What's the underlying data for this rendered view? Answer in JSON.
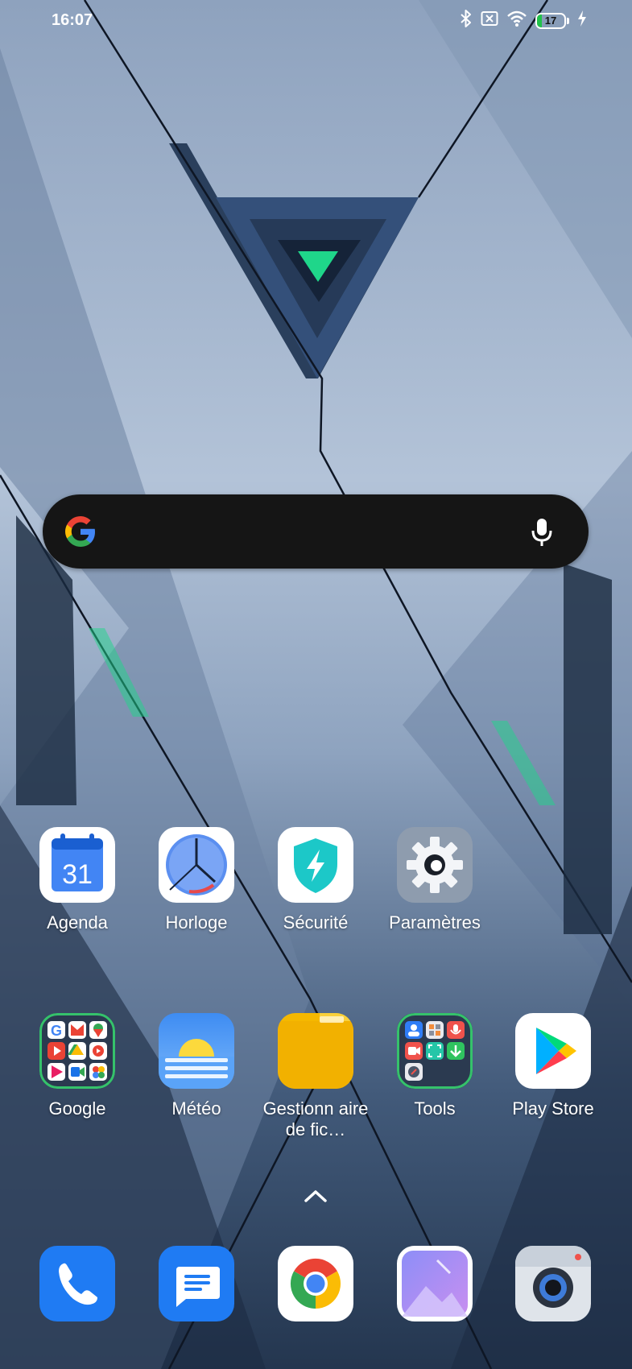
{
  "status_bar": {
    "time": "16:07",
    "icons": [
      "bluetooth-icon",
      "no-sim-icon",
      "wifi-icon",
      "battery-icon",
      "charging-icon"
    ],
    "battery_level": "17",
    "battery_fraction": 0.17
  },
  "search": {
    "icons": [
      "google-g-icon",
      "microphone-icon"
    ]
  },
  "home_row_1": [
    {
      "label": "Agenda",
      "icon": "calendar-icon",
      "badge_text": "31"
    },
    {
      "label": "Horloge",
      "icon": "clock-icon"
    },
    {
      "label": "Sécurité",
      "icon": "security-shield-icon"
    },
    {
      "label": "Paramètres",
      "icon": "settings-gear-icon"
    }
  ],
  "home_row_2": [
    {
      "label": "Google",
      "icon": "google-folder-icon"
    },
    {
      "label": "Météo",
      "icon": "weather-icon"
    },
    {
      "label": "Gestionn aire de fic…",
      "icon": "file-manager-folder-icon"
    },
    {
      "label": "Tools",
      "icon": "tools-folder-icon"
    },
    {
      "label": "Play Store",
      "icon": "play-store-icon"
    }
  ],
  "dock": [
    {
      "name": "phone",
      "icon": "phone-icon"
    },
    {
      "name": "messages",
      "icon": "messages-icon"
    },
    {
      "name": "chrome",
      "icon": "chrome-icon"
    },
    {
      "name": "gallery",
      "icon": "gallery-icon"
    },
    {
      "name": "camera",
      "icon": "camera-icon"
    }
  ],
  "colors": {
    "wallpaper_light": "#a9bad0",
    "wallpaper_dark": "#1f3048",
    "accent_green": "#1fd68a",
    "search_bar": "#151515",
    "battery_green": "#21c24a"
  }
}
